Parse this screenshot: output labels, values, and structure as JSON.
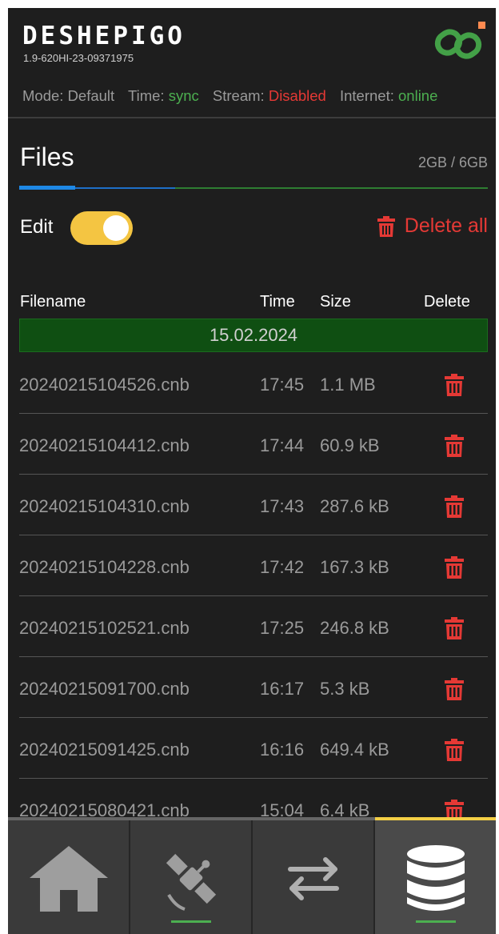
{
  "app": {
    "logo": "DESHEPIGO",
    "serial": "1.9-620HI-23-09371975"
  },
  "status": {
    "mode_label": "Mode:",
    "mode_value": "Default",
    "time_label": "Time:",
    "time_value": "sync",
    "stream_label": "Stream:",
    "stream_value": "Disabled",
    "internet_label": "Internet:",
    "internet_value": "online"
  },
  "files": {
    "title": "Files",
    "storage": "2GB / 6GB",
    "used_fraction": 0.3333,
    "edit_label": "Edit",
    "edit_enabled": true,
    "delete_all_label": "Delete all",
    "columns": {
      "filename": "Filename",
      "time": "Time",
      "size": "Size",
      "delete": "Delete"
    },
    "date_group": "15.02.2024",
    "rows": [
      {
        "filename": "20240215104526.cnb",
        "time": "17:45",
        "size": "1.1 MB"
      },
      {
        "filename": "20240215104412.cnb",
        "time": "17:44",
        "size": "60.9 kB"
      },
      {
        "filename": "20240215104310.cnb",
        "time": "17:43",
        "size": "287.6 kB"
      },
      {
        "filename": "20240215104228.cnb",
        "time": "17:42",
        "size": "167.3 kB"
      },
      {
        "filename": "20240215102521.cnb",
        "time": "17:25",
        "size": "246.8 kB"
      },
      {
        "filename": "20240215091700.cnb",
        "time": "16:17",
        "size": "5.3 kB"
      },
      {
        "filename": "20240215091425.cnb",
        "time": "16:16",
        "size": "649.4 kB"
      },
      {
        "filename": "20240215080421.cnb",
        "time": "15:04",
        "size": "6.4 kB"
      }
    ]
  },
  "nav": {
    "items": [
      {
        "icon": "home-icon",
        "active": false,
        "underline": false
      },
      {
        "icon": "satellite-icon",
        "active": false,
        "underline": true
      },
      {
        "icon": "transfer-icon",
        "active": false,
        "underline": false
      },
      {
        "icon": "database-icon",
        "active": true,
        "underline": true
      }
    ]
  },
  "colors": {
    "ok": "#4caf50",
    "error": "#e53935",
    "accent_yellow": "#f4c542",
    "link_green": "#43a047",
    "notification_orange": "#ff8a50"
  }
}
